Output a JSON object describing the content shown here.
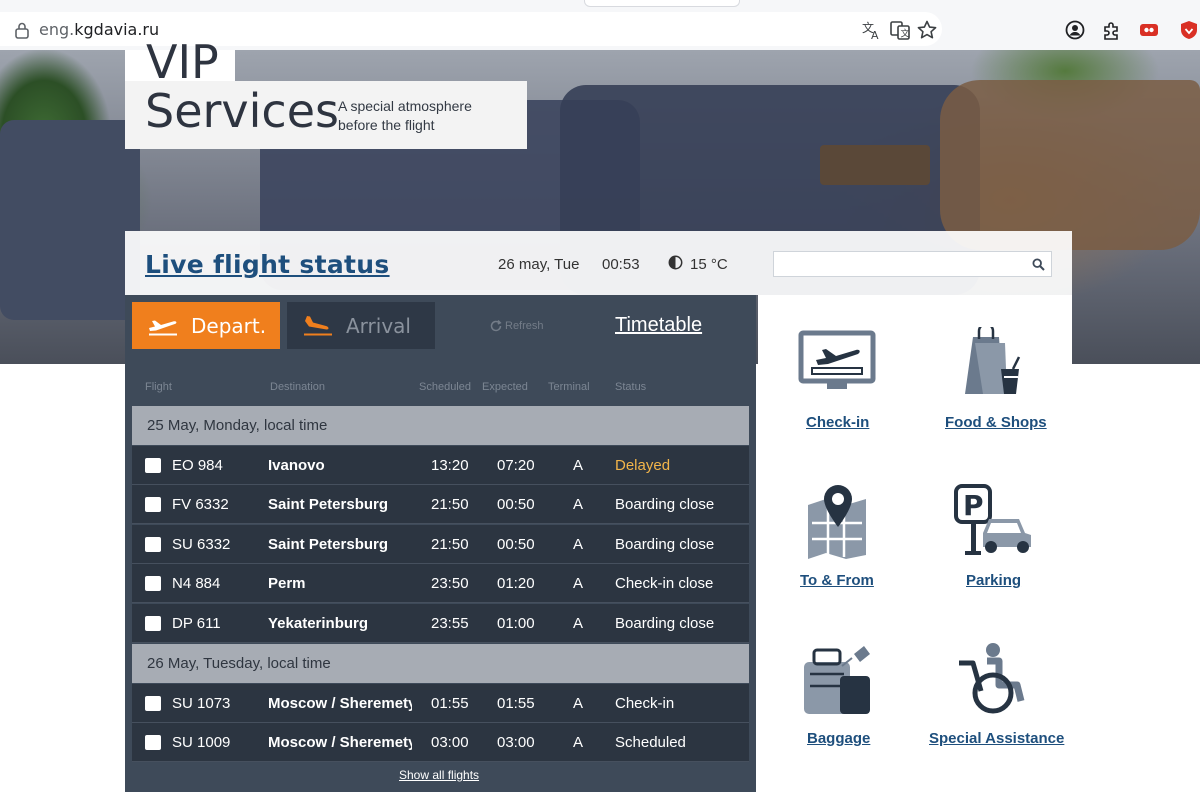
{
  "browser": {
    "url_prefix": "eng.",
    "url_host": "kgdavia.ru",
    "url_suffix": ".ru"
  },
  "hero": {
    "title_line1": "VIP",
    "title_line2": "Services",
    "subtitle_line1": "A special atmosphere",
    "subtitle_line2": "before the flight"
  },
  "status_header": {
    "title": "Live flight status",
    "date": "26 may, Tue",
    "time": "00:53",
    "temperature": "15 °C",
    "search_placeholder": ""
  },
  "tabs": {
    "depart": "Depart.",
    "arrival": "Arrival",
    "refresh": "Refresh",
    "timetable": "Timetable"
  },
  "columns": {
    "flight": "Flight",
    "destination": "Destination",
    "scheduled": "Scheduled",
    "expected": "Expected",
    "terminal": "Terminal",
    "status": "Status"
  },
  "days": [
    {
      "label": "25 May, Monday, local time"
    },
    {
      "label": "26 May, Tuesday, local time"
    }
  ],
  "flights": [
    {
      "flight": "EO 984",
      "destination": "Ivanovo",
      "scheduled": "13:20",
      "expected": "07:20",
      "terminal": "A",
      "status": "Delayed"
    },
    {
      "flight": "FV 6332",
      "destination": "Saint Petersburg",
      "scheduled": "21:50",
      "expected": "00:50",
      "terminal": "A",
      "status": "Boarding close"
    },
    {
      "flight": "SU 6332",
      "destination": "Saint Petersburg",
      "scheduled": "21:50",
      "expected": "00:50",
      "terminal": "A",
      "status": "Boarding close"
    },
    {
      "flight": "N4 884",
      "destination": "Perm",
      "scheduled": "23:50",
      "expected": "01:20",
      "terminal": "A",
      "status": "Check-in close"
    },
    {
      "flight": "DP 611",
      "destination": "Yekaterinburg",
      "scheduled": "23:55",
      "expected": "01:00",
      "terminal": "A",
      "status": "Boarding close"
    },
    {
      "flight": "SU 1073",
      "destination": "Moscow / Sheremetyevo",
      "scheduled": "01:55",
      "expected": "01:55",
      "terminal": "A",
      "status": "Check-in"
    },
    {
      "flight": "SU 1009",
      "destination": "Moscow / Sheremetyevo",
      "scheduled": "03:00",
      "expected": "03:00",
      "terminal": "A",
      "status": "Scheduled"
    }
  ],
  "show_all": "Show all flights",
  "services": [
    {
      "label": "Check-in",
      "icon": "checkin-monitor-icon"
    },
    {
      "label": "Food & Shops",
      "icon": "shopping-bag-icon"
    },
    {
      "label": "To & From",
      "icon": "map-pin-icon"
    },
    {
      "label": "Parking",
      "icon": "parking-car-icon"
    },
    {
      "label": "Baggage",
      "icon": "baggage-icon"
    },
    {
      "label": "Special Assistance",
      "icon": "wheelchair-icon"
    }
  ],
  "colors": {
    "accent_orange": "#f07f1d",
    "board_bg": "#3e4a59",
    "row_bg": "#2c3541",
    "day_row_bg": "#a7acb4",
    "link_blue": "#1e4f7d",
    "delayed": "#f3b54a",
    "icon_slate": "#6b7a8d"
  }
}
